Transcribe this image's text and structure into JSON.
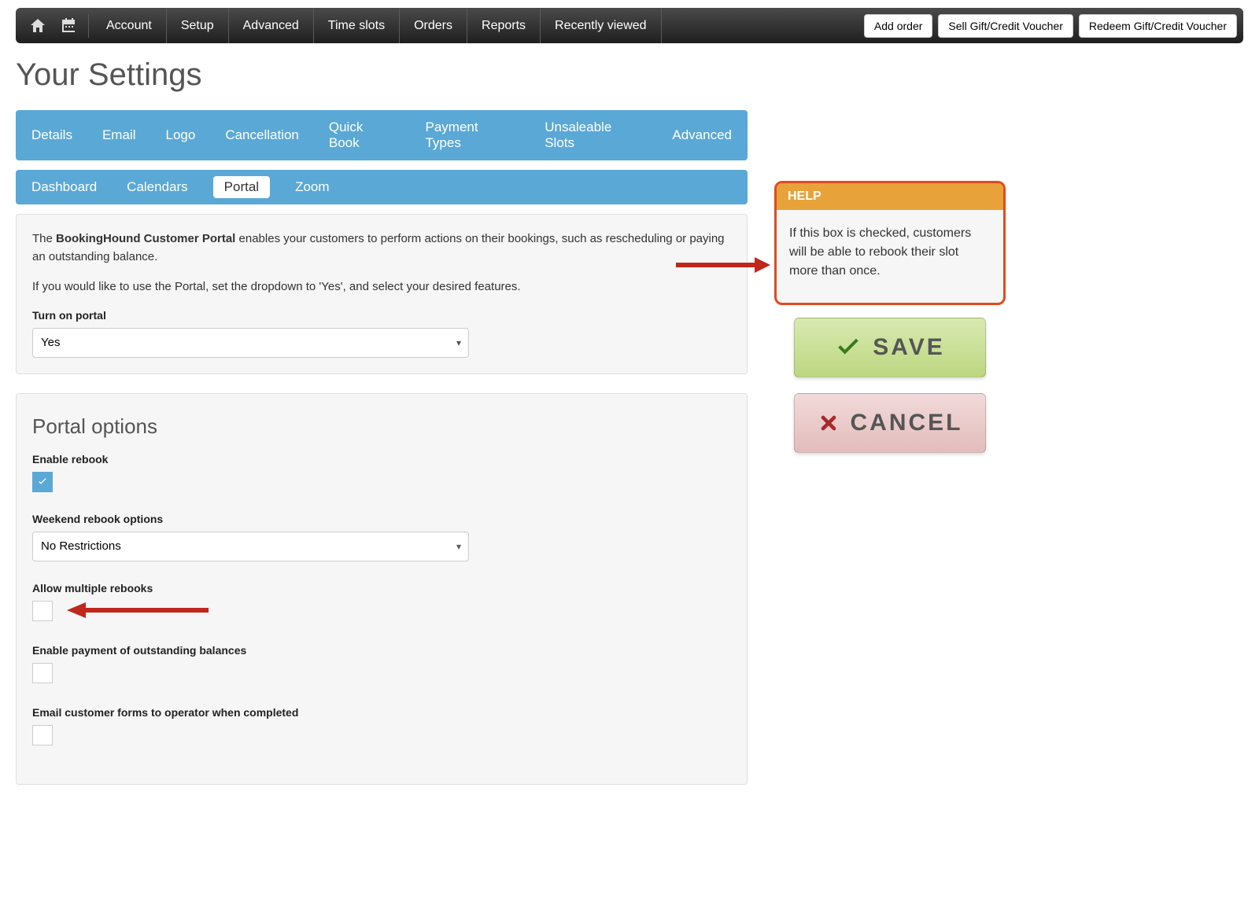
{
  "nav": {
    "items": [
      "Account",
      "Setup",
      "Advanced",
      "Time slots",
      "Orders",
      "Reports",
      "Recently viewed"
    ],
    "buttons": [
      "Add order",
      "Sell Gift/Credit Voucher",
      "Redeem Gift/Credit Voucher"
    ]
  },
  "page_title": "Your Settings",
  "tabs_primary": [
    "Details",
    "Email",
    "Logo",
    "Cancellation",
    "Quick Book",
    "Payment Types",
    "Unsaleable Slots",
    "Advanced"
  ],
  "tabs_secondary": [
    "Dashboard",
    "Calendars",
    "Portal",
    "Zoom"
  ],
  "tabs_secondary_active": "Portal",
  "intro": {
    "pre": "The ",
    "bold": "BookingHound Customer Portal",
    "post": " enables your customers to perform actions on their bookings, such as rescheduling or paying an outstanding balance.",
    "line2": "If you would like to use the Portal, set the dropdown to 'Yes', and select your desired features."
  },
  "turn_on": {
    "label": "Turn on portal",
    "value": "Yes"
  },
  "options": {
    "title": "Portal options",
    "enable_rebook": {
      "label": "Enable rebook",
      "checked": true
    },
    "weekend": {
      "label": "Weekend rebook options",
      "value": "No Restrictions"
    },
    "multiple_rebooks": {
      "label": "Allow multiple rebooks",
      "checked": false
    },
    "enable_payment": {
      "label": "Enable payment of outstanding balances",
      "checked": false
    },
    "email_forms": {
      "label": "Email customer forms to operator when completed",
      "checked": false
    }
  },
  "help": {
    "title": "HELP",
    "body": "If this box is checked, customers will be able to rebook their slot more than once."
  },
  "actions": {
    "save": "SAVE",
    "cancel": "CANCEL"
  }
}
